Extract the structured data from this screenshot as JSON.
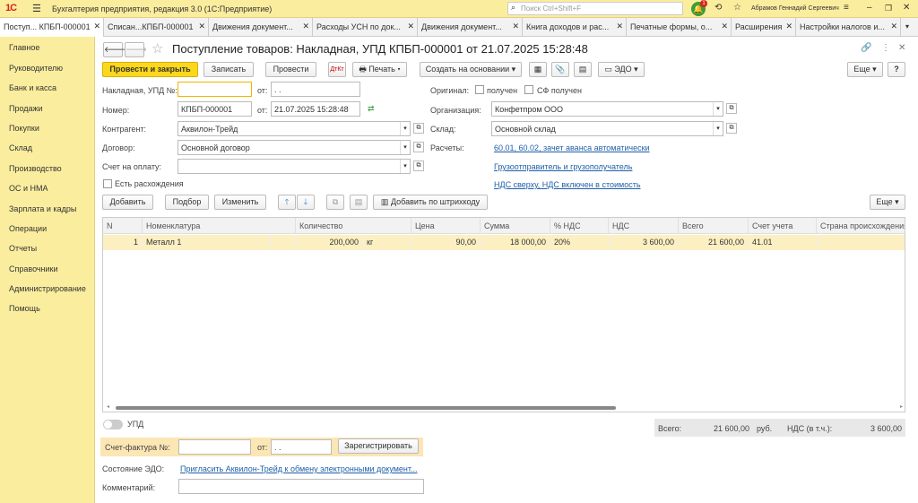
{
  "app": {
    "logo": "1С",
    "title": "Бухгалтерия предприятия, редакция 3.0  (1С:Предприятие)",
    "search_placeholder": "Поиск Ctrl+Shift+F",
    "notif_count": "1",
    "user": "Абрамов Геннадий Сергеевич"
  },
  "tabs": [
    "Поступ... КПБП-000001",
    "Списан...КПБП-000001",
    "Движения документ...",
    "Расходы УСН по док...",
    "Движения документ...",
    "Книга доходов и рас...",
    "Печатные формы, о...",
    "Расширения",
    "Настройки налогов и..."
  ],
  "sidebar": [
    "Главное",
    "Руководителю",
    "Банк и касса",
    "Продажи",
    "Покупки",
    "Склад",
    "Производство",
    "ОС и НМА",
    "Зарплата и кадры",
    "Операции",
    "Отчеты",
    "Справочники",
    "Администрирование",
    "Помощь"
  ],
  "doc": {
    "title": "Поступление товаров: Накладная, УПД КПБП-000001 от 21.07.2025 15:28:48"
  },
  "toolbar": {
    "post_close": "Провести и закрыть",
    "save": "Записать",
    "post": "Провести",
    "print": "Печать",
    "create_based": "Создать на основании",
    "edo": "ЭДО",
    "more": "Еще",
    "help": "?"
  },
  "form": {
    "invoice_label": "Накладная, УПД №:",
    "invoice_value": "",
    "from1": "от:",
    "date_empty": "  .  .",
    "number_label": "Номер:",
    "number_value": "КПБП-000001",
    "from2": "от:",
    "date_value": "21.07.2025 15:28:48",
    "contractor_label": "Контрагент:",
    "contractor_value": "Аквилон-Трейд",
    "contract_label": "Договор:",
    "contract_value": "Основной договор",
    "payinv_label": "Счет на оплату:",
    "payinv_value": "",
    "discrepancy": "Есть расхождения",
    "original_label": "Оригинал:",
    "received": "получен",
    "sf_received": "СФ получен",
    "org_label": "Организация:",
    "org_value": "Конфетпром ООО",
    "warehouse_label": "Склад:",
    "warehouse_value": "Основной склад",
    "calc_label": "Расчеты:",
    "calc_link": "60.01, 60.02, зачет аванса автоматически",
    "shipper_link": "Грузоотправитель и грузополучатель",
    "vat_link": "НДС сверху, НДС включен в стоимость"
  },
  "table_toolbar": {
    "add": "Добавить",
    "pick": "Подбор",
    "change": "Изменить",
    "barcode": "Добавить по штрихкоду",
    "more": "Еще"
  },
  "table": {
    "headers": [
      "N",
      "Номенклатура",
      "Количество",
      "Цена",
      "Сумма",
      "% НДС",
      "НДС",
      "Всего",
      "Счет учета",
      "Страна происхождения"
    ],
    "rows": [
      {
        "n": "1",
        "name": "Металл 1",
        "qty": "200,000",
        "unit": "кг",
        "price": "90,00",
        "sum": "18 000,00",
        "vat_rate": "20%",
        "vat": "3 600,00",
        "total": "21 600,00",
        "account": "41.01",
        "country": ""
      }
    ]
  },
  "footer": {
    "upd": "УПД",
    "total_label": "Всего:",
    "total_value": "21 600,00",
    "currency": "руб.",
    "vat_label": "НДС (в т.ч.):",
    "vat_value": "3 600,00",
    "sf_label": "Счет-фактура №:",
    "sf_from": "от:",
    "sf_date": "  .  .",
    "register": "Зарегистрировать",
    "edo_label": "Состояние ЭДО:",
    "edo_link": "Пригласить Аквилон-Трейд к обмену электронными документ...",
    "comment_label": "Комментарий:"
  }
}
